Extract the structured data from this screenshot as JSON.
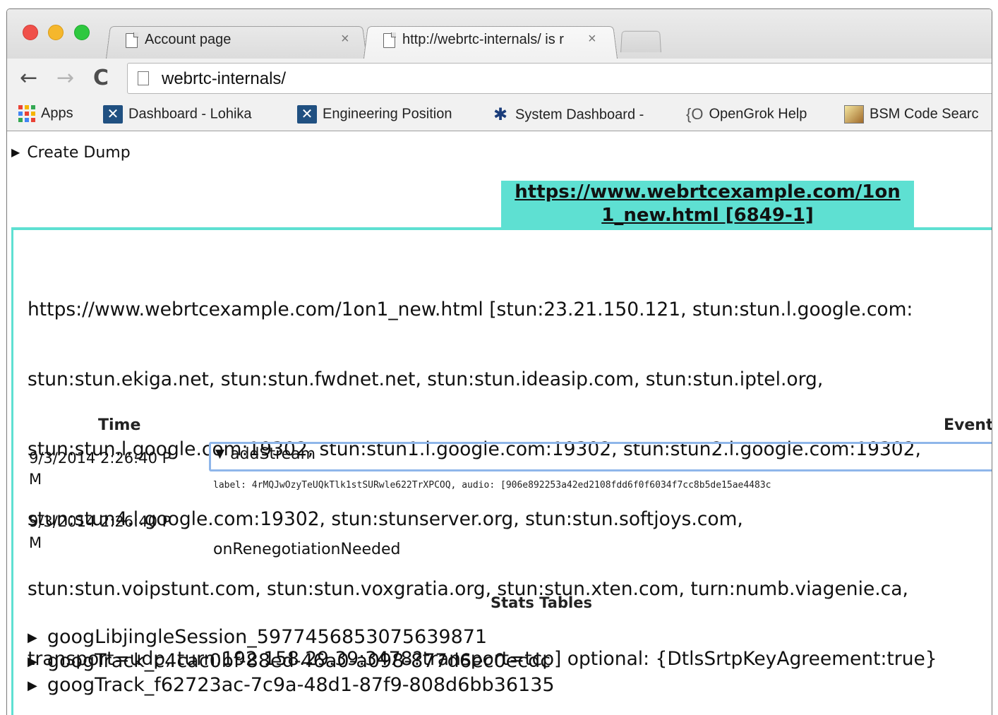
{
  "tabs": [
    {
      "title": "Account page",
      "close": "×"
    },
    {
      "title": "http://webrtc-internals/ is r",
      "close": "×"
    }
  ],
  "toolbar": {
    "back": "←",
    "forward": "→",
    "reload": "C",
    "url": "webrtc-internals/"
  },
  "bookmarks": [
    {
      "label": "Apps",
      "icon": "apps-grid-icon"
    },
    {
      "label": "Dashboard - Lohika",
      "icon": "jira-icon"
    },
    {
      "label": "Engineering Position",
      "icon": "jira-icon"
    },
    {
      "label": "System Dashboard -",
      "icon": "system-dashboard-icon"
    },
    {
      "label": "OpenGrok Help",
      "icon": "opengrok-icon",
      "icon_text": "{O"
    },
    {
      "label": "BSM Code Searc",
      "icon": "bsm-icon"
    }
  ],
  "page": {
    "create_dump": "Create Dump",
    "peer_tab": "https://www.webrtcexample.com/1on1_new.html [6849-1]",
    "peer_tab_lines": [
      "https://www.webrtcexample.com/1on",
      "1_new.html [6849-1]"
    ],
    "config_lines": [
      "https://www.webrtcexample.com/1on1_new.html [stun:23.21.150.121, stun:stun.l.google.com:",
      "stun:stun.ekiga.net, stun:stun.fwdnet.net, stun:stun.ideasip.com, stun:stun.iptel.org,",
      "stun:stun.l.google.com:19302, stun:stun1.l.google.com:19302, stun:stun2.l.google.com:19302,",
      "stun:stun4.l.google.com:19302, stun:stunserver.org, stun:stun.softjoys.com,",
      "stun:stun.voipstunt.com, stun:stun.voxgratia.org, stun:stun.xten.com, turn:numb.viagenie.ca,",
      "transport=udp, turn:192.158.29.39:3478?transport=tcp] optional: {DtlsSrtpKeyAgreement:true}"
    ],
    "log": {
      "time_header": "Time",
      "event_header": "Event",
      "rows": [
        {
          "time_line1": "9/3/2014 2:26:40 P",
          "time_line2": "M",
          "event": "addStream",
          "detail": "label: 4rMQJwOzyTeUQkTlk1stSURwle622TrXPCOQ, audio: [906e892253a42ed2108fdd6f0f6034f7cc8b5de15ae4483c"
        },
        {
          "time_line1": "9/3/2014 2:26:40 P",
          "time_line2": "M",
          "event": "onRenegotiationNeeded"
        }
      ]
    },
    "stats_header": "Stats Tables",
    "stats_tables": [
      "googLibjingleSession_5977456853075639871",
      "googTrack_c4cac0bf-88ed-46a0-a098-877d6ec0ecdc",
      "googTrack_f62723ac-7c9a-48d1-87f9-808d6bb36135"
    ]
  },
  "colors": {
    "peer_tab_bg": "#5ee0d2",
    "event_box_border": "#8fb6ea"
  }
}
